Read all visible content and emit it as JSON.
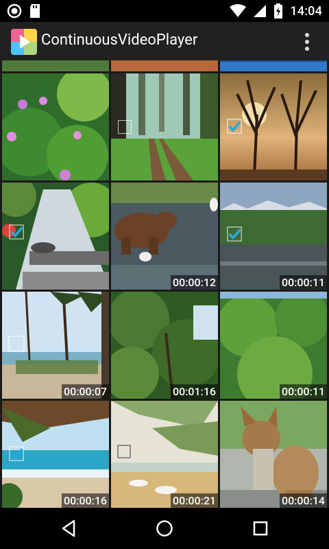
{
  "status_bar": {
    "time": "14:04"
  },
  "app_bar": {
    "title": "ContinuousVideoPlayer"
  },
  "videos": [
    {
      "duration": ""
    },
    {
      "duration": ""
    },
    {
      "duration": ""
    },
    {
      "duration": "00:00:12"
    },
    {
      "duration": "00:00:11"
    },
    {
      "duration": "00:00:07"
    },
    {
      "duration": "00:01:16"
    },
    {
      "duration": "00:00:11"
    },
    {
      "duration": "00:00:16"
    },
    {
      "duration": "00:00:21"
    },
    {
      "duration": "00:00:14"
    }
  ],
  "colors": {
    "app_bar": "#212121",
    "check_accent": "#29a8e0",
    "background": "#000000"
  },
  "icons": [
    "signal-icon",
    "sd-card-icon",
    "wifi-icon",
    "cell-signal-icon",
    "battery-charging-icon",
    "overflow-menu-icon",
    "back-icon",
    "home-icon",
    "recents-icon"
  ]
}
